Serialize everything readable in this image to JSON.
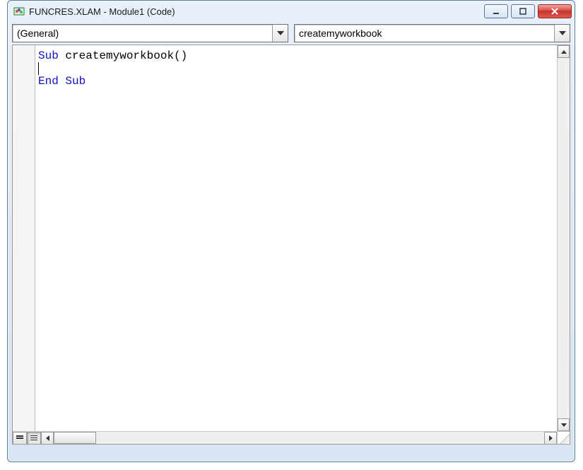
{
  "window": {
    "title": "FUNCRES.XLAM - Module1 (Code)"
  },
  "dropdowns": {
    "object_selected": "(General)",
    "procedure_selected": "createmyworkbook"
  },
  "code": {
    "line1_kw": "Sub",
    "line1_rest": " createmyworkbook()",
    "line3_kw": "End Sub"
  }
}
